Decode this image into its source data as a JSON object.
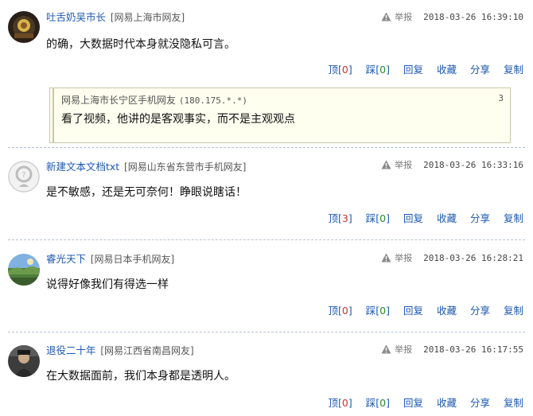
{
  "report_label": "举报",
  "actions": {
    "up_label": "顶",
    "down_label": "踩",
    "reply_label": "回复",
    "fav_label": "收藏",
    "share_label": "分享",
    "copy_label": "复制"
  },
  "comments": [
    {
      "user": "吐舌奶吴市长",
      "location": "[网易上海市网友]",
      "datetime": "2018-03-26 16:39:10",
      "text": "的确，大数据时代本身就没隐私可言。",
      "up": "0",
      "down": "0",
      "quote": {
        "user": "网易上海市长宁区手机网友",
        "ip": "(180.175.*.*)",
        "floor": "3",
        "text": "看了视频，他讲的是客观事实，而不是主观观点"
      }
    },
    {
      "user": "新建文本文档txt",
      "location": "[网易山东省东营市手机网友]",
      "datetime": "2018-03-26 16:33:16",
      "text": "是不敏感，还是无可奈何！睁眼说瞎话！",
      "up": "3",
      "down": "0"
    },
    {
      "user": "睿光天下",
      "location": "[网易日本手机网友]",
      "datetime": "2018-03-26 16:28:21",
      "text": "说得好像我们有得选一样",
      "up": "0",
      "down": "0"
    },
    {
      "user": "退役二十年",
      "location": "[网易江西省南昌网友]",
      "datetime": "2018-03-26 16:17:55",
      "text": "在大数据面前，我们本身都是透明人。",
      "up": "0",
      "down": "0"
    }
  ]
}
